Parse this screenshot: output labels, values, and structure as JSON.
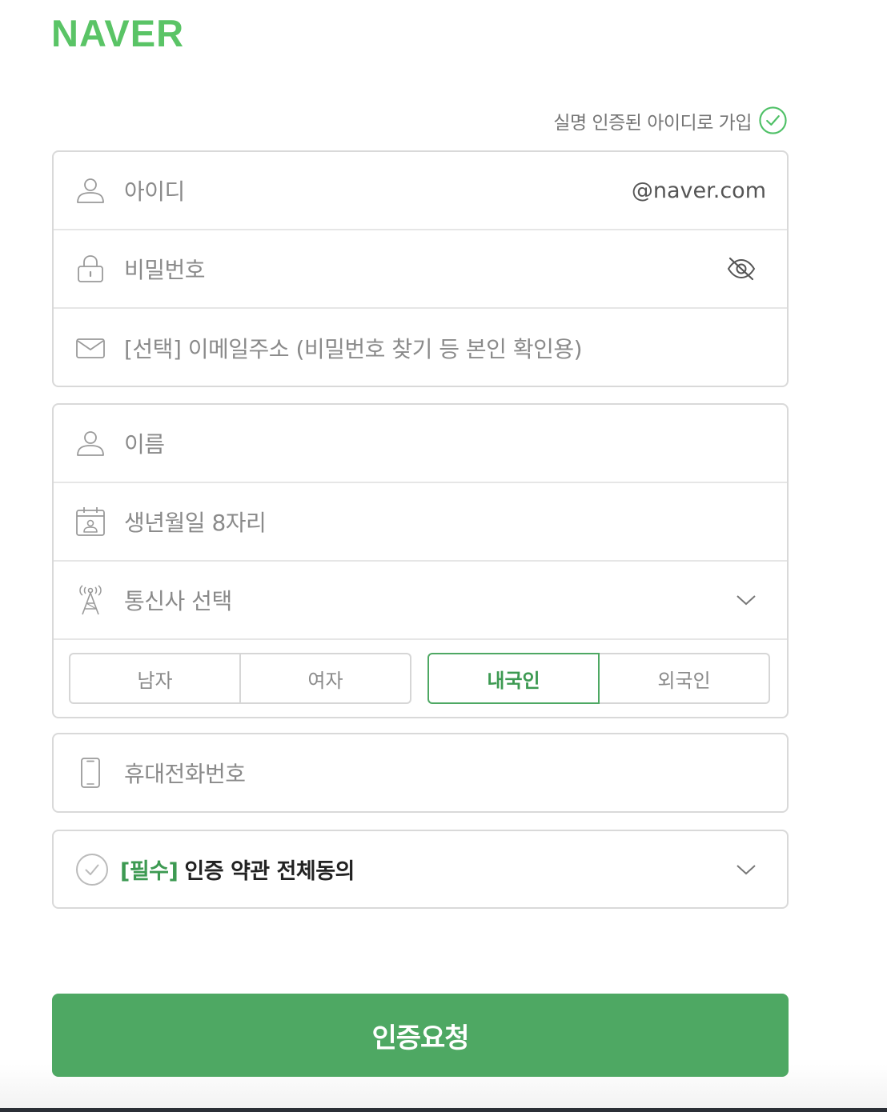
{
  "brand": {
    "logo_text": "NAVER",
    "accent": "#5ac466",
    "button_color": "#4ea863"
  },
  "verified_signup": {
    "label": "실명 인증된 아이디로 가입",
    "icon": "check-circle-icon"
  },
  "account_fields": {
    "id": {
      "placeholder": "아이디",
      "suffix": "@naver.com",
      "icon": "user-icon"
    },
    "password": {
      "placeholder": "비밀번호",
      "icon": "lock-icon",
      "toggle_icon": "eye-slash-icon"
    },
    "email": {
      "placeholder": "[선택] 이메일주소 (비밀번호 찾기 등 본인 확인용)",
      "icon": "mail-icon"
    }
  },
  "profile_fields": {
    "name": {
      "placeholder": "이름",
      "icon": "user-icon"
    },
    "birth": {
      "placeholder": "생년월일 8자리",
      "icon": "calendar-icon"
    },
    "carrier": {
      "placeholder": "통신사 선택",
      "icon": "antenna-icon",
      "dropdown_icon": "chevron-down-icon"
    },
    "gender": {
      "options": [
        "남자",
        "여자"
      ],
      "selected": null
    },
    "nationality": {
      "options": [
        "내국인",
        "외국인"
      ],
      "selected": "내국인"
    }
  },
  "phone_field": {
    "placeholder": "휴대전화번호",
    "icon": "phone-icon"
  },
  "terms": {
    "required_tag": "[필수]",
    "label": "인증 약관 전체동의",
    "checked": false
  },
  "submit": {
    "label": "인증요청"
  }
}
